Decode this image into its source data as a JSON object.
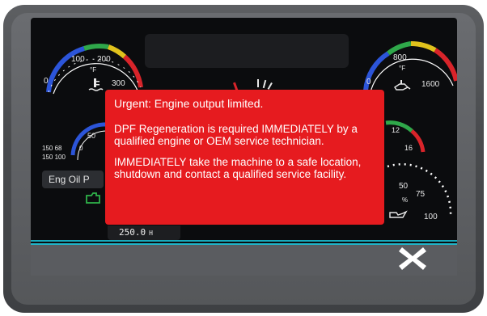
{
  "alert": {
    "title": "Urgent: Engine output limited.",
    "line1": "DPF Regeneration is required IMMEDIATELY by a qualified engine or OEM service technician.",
    "line2": "IMMEDIATELY take the machine to a safe location, shutdown and contact a qualified service facility."
  },
  "gauges": {
    "coolant": {
      "t0": "0",
      "t100": "100",
      "t200": "200",
      "unit": "°F",
      "t300": "300",
      "icon": "coolant-temp-icon"
    },
    "hydraulic": {
      "t0": "0",
      "t800": "800",
      "unit": "°F",
      "t1600": "1600",
      "icon": "hydraulic-oil-temp-icon"
    },
    "left_mid": {
      "t50": "50",
      "t150": "150 68",
      "t0": "0",
      "t150b": "150 100"
    },
    "right_mid": {
      "t12": "12",
      "t16": "16"
    },
    "oil": {
      "t50": "50",
      "t75": "75",
      "t100": "100",
      "unit": "%"
    }
  },
  "labels": {
    "eng_oil": "Eng Oil P",
    "hours_value": "250.0",
    "hours_unit": "H"
  },
  "colors": {
    "alert_bg": "#e61b1f",
    "accent_line": "#19a9bb"
  }
}
